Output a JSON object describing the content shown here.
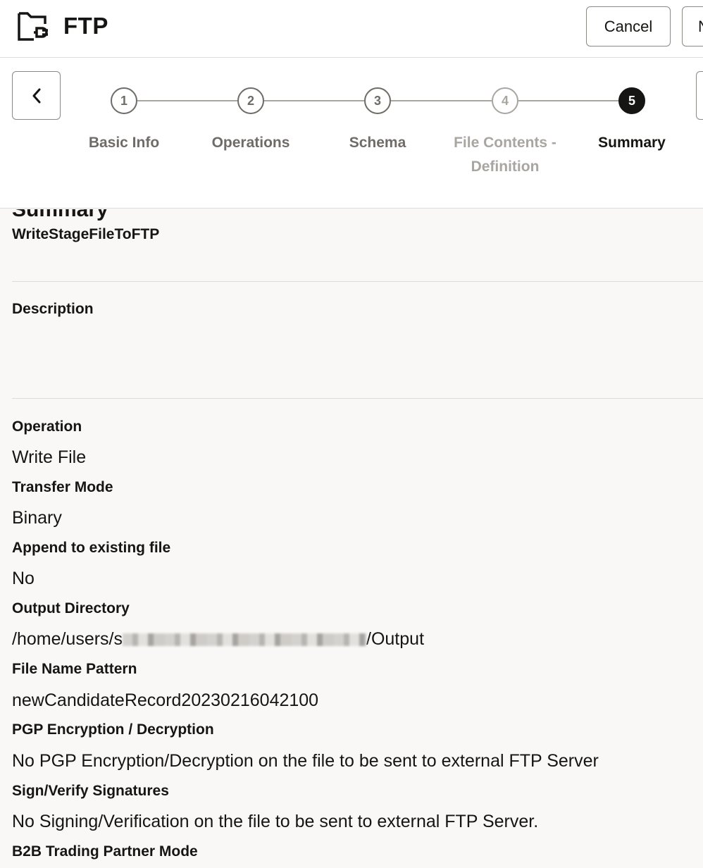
{
  "header": {
    "app_title": "FTP",
    "cancel_label": "Cancel",
    "next_label": "N",
    "icon": "folder-plug-icon"
  },
  "train": {
    "steps": [
      {
        "number": "1",
        "label": "Basic Info",
        "state": "visited"
      },
      {
        "number": "2",
        "label": "Operations",
        "state": "visited"
      },
      {
        "number": "3",
        "label": "Schema",
        "state": "visited"
      },
      {
        "number": "4",
        "label_line1": "File Contents -",
        "label_line2": "Definition",
        "state": "disabled"
      },
      {
        "number": "5",
        "label": "Summary",
        "state": "current"
      }
    ]
  },
  "summary": {
    "partial_heading": "Summary",
    "name": "WriteStageFileToFTP",
    "description_label": "Description",
    "description_value": "",
    "fields": [
      {
        "label": "Operation",
        "value": "Write File"
      },
      {
        "label": "Transfer Mode",
        "value": "Binary"
      },
      {
        "label": "Append to existing file",
        "value": "No"
      },
      {
        "label": "Output Directory",
        "value_prefix": "/home/users/s",
        "value_suffix": "/Output"
      },
      {
        "label": "File Name Pattern",
        "value": "newCandidateRecord20230216042100"
      },
      {
        "label": "PGP Encryption / Decryption",
        "value": "No PGP Encryption/Decryption on the file to be sent to external FTP Server"
      },
      {
        "label": "Sign/Verify Signatures",
        "value": "No Signing/Verification on the file to be sent to external FTP Server."
      },
      {
        "label": "B2B Trading Partner Mode",
        "value": ""
      }
    ]
  },
  "colors": {
    "background": "#f9f8f6",
    "text": "#161513",
    "muted": "#6f6c68",
    "disabled": "#a9a6a1",
    "border": "#dfdcd8"
  }
}
